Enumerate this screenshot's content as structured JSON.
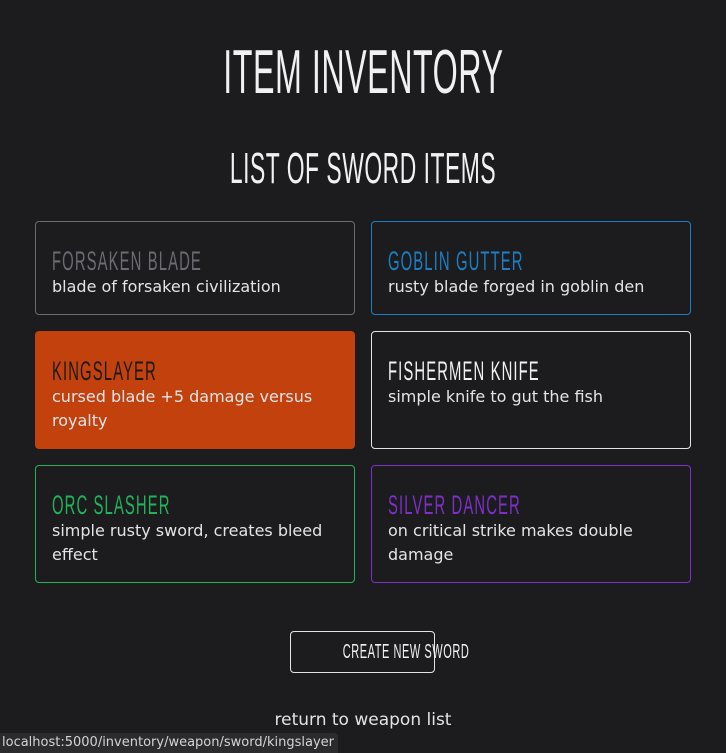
{
  "page": {
    "title": "ITEM INVENTORY",
    "subtitle": "LIST OF SWORD ITEMS"
  },
  "items": [
    {
      "name": "FORSAKEN BLADE",
      "description": "blade of forsaken civilization",
      "name_color": "#6b6b73",
      "border_color": "#6b6b70",
      "bg": "transparent"
    },
    {
      "name": "GOBLIN GUTTER",
      "description": "rusty blade forged in goblin den",
      "name_color": "#1e7ec4",
      "border_color": "#1e7ec4",
      "bg": "transparent"
    },
    {
      "name": "KINGSLAYER",
      "description": "cursed blade +5 damage versus royalty",
      "name_color": "#1a1a1a",
      "border_color": "#c2410c",
      "bg": "#c2410c"
    },
    {
      "name": "FISHERMEN KNIFE",
      "description": "simple knife to gut the fish",
      "name_color": "#f1f1f4",
      "border_color": "#e4e4e7",
      "bg": "transparent"
    },
    {
      "name": "ORC SLASHER",
      "description": "simple rusty sword, creates bleed effect",
      "name_color": "#22b35a",
      "border_color": "#22b35a",
      "bg": "transparent"
    },
    {
      "name": "SILVER DANCER",
      "description": "on critical strike makes double damage",
      "name_color": "#7e2fc9",
      "border_color": "#7e2fc9",
      "bg": "transparent"
    }
  ],
  "actions": {
    "create_label": "CREATE NEW SWORD",
    "return_label": "return to weapon list"
  },
  "status_bar": {
    "url": "localhost:5000/inventory/weapon/sword/kingslayer"
  }
}
